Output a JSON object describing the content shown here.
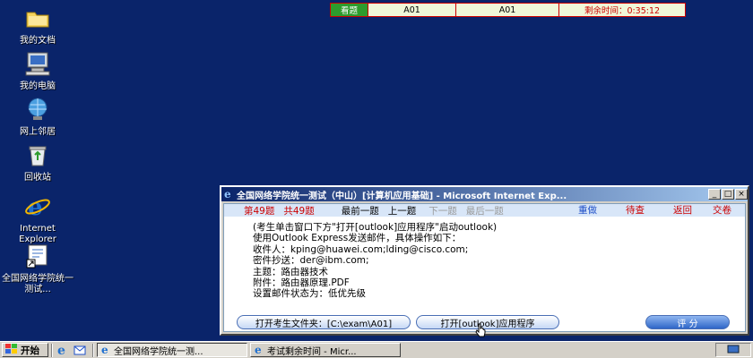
{
  "desktop": {
    "icons": [
      {
        "label": "我的文档",
        "icon": "folder-icon"
      },
      {
        "label": "我的电脑",
        "icon": "computer-icon"
      },
      {
        "label": "网上邻居",
        "icon": "network-icon"
      },
      {
        "label": "回收站",
        "icon": "recycle-bin-icon"
      },
      {
        "label": "Internet Explorer",
        "icon": "ie-icon"
      },
      {
        "label": "全国网络学院统一测试...",
        "icon": "shortcut-icon"
      }
    ]
  },
  "exam_bar": {
    "status": "看题",
    "code1": "A01",
    "code2": "A01",
    "time_label": "剩余时间：0:35:12"
  },
  "window": {
    "title": "全国网络学院统一测试（中山）[计算机应用基础] - Microsoft Internet Exp...",
    "nav": {
      "current": "第49题",
      "total": "共49题",
      "first": "最前一题",
      "prev": "上一题",
      "next": "下一题",
      "last": "最后一题",
      "redo": "重做",
      "review": "待查",
      "back": "返回",
      "submit": "交卷"
    },
    "question_lines": [
      "(考生单击窗口下方\"打开[outlook]应用程序\"启动outlook)",
      "使用Outlook Express发送邮件，具体操作如下：",
      "收件人：kping@huawei.com;lding@cisco.com;",
      "密件抄送：der@ibm.com;",
      "主题：路由器技术",
      "附件：路由器原理.PDF",
      "设置邮件状态为：低优先级"
    ],
    "buttons": {
      "open_folder": "打开考生文件夹：[C:\\exam\\A01]",
      "open_outlook": "打开[outlook]应用程序",
      "score": "评 分"
    }
  },
  "taskbar": {
    "start": "开始",
    "tasks": [
      "全国网络学院统一测...",
      "考试剩余时间 - Micr..."
    ]
  },
  "colors": {
    "desktop": "#0a246a",
    "accent_red": "#cc0000",
    "status_green": "#2d9b2d"
  }
}
